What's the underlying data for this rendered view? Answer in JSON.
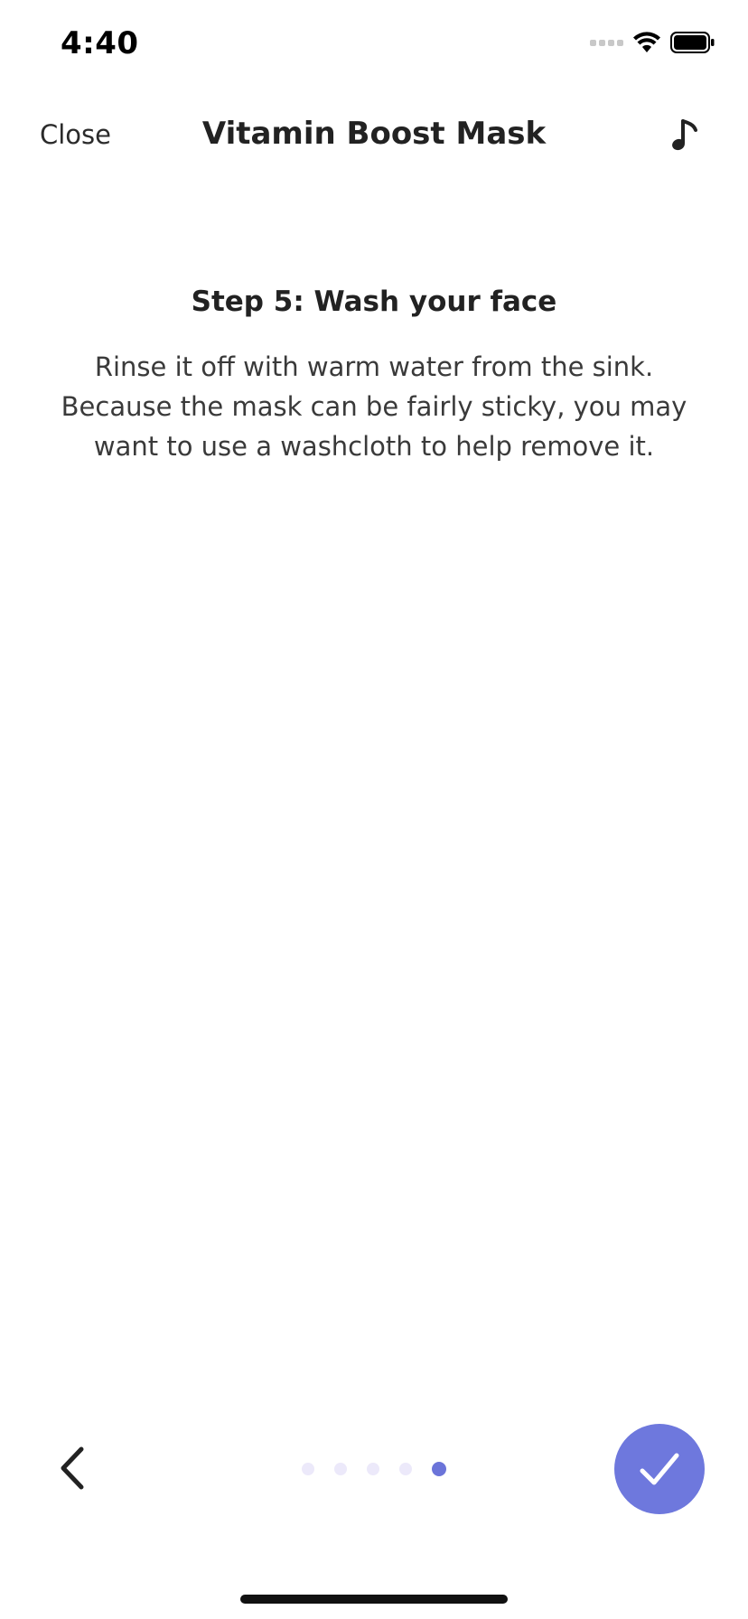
{
  "status_bar": {
    "time": "4:40",
    "icons": [
      "cellular-signal-icon",
      "wifi-icon",
      "battery-icon"
    ]
  },
  "nav": {
    "close_label": "Close",
    "title": "Vitamin Boost Mask",
    "music_icon": "music-note-icon"
  },
  "step": {
    "title": "Step 5: Wash your face",
    "body": "Rinse it off with warm water from the sink. Because the mask can be fairly sticky, you may want to use a washcloth to help remove it."
  },
  "pager": {
    "total_pages": 5,
    "current_page": 5
  },
  "controls": {
    "back_icon": "chevron-left-icon",
    "done_icon": "checkmark-icon"
  },
  "colors": {
    "accent": "#6e78dd",
    "dot_active": "#6b74d9",
    "dot_inactive": "#ece9fa",
    "text": "#2b2b2b"
  }
}
